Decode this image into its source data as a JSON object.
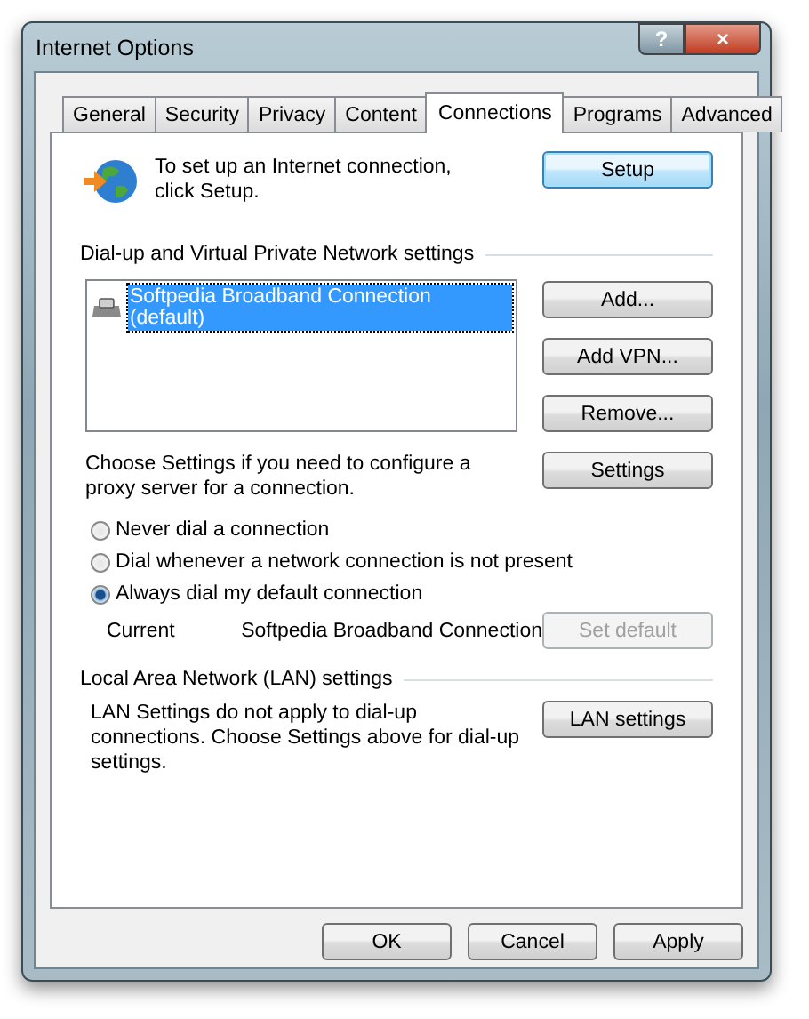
{
  "window": {
    "title": "Internet Options",
    "help": "?",
    "close": "×"
  },
  "tabs": [
    {
      "label": "General",
      "selected": false
    },
    {
      "label": "Security",
      "selected": false
    },
    {
      "label": "Privacy",
      "selected": false
    },
    {
      "label": "Content",
      "selected": false
    },
    {
      "label": "Connections",
      "selected": true
    },
    {
      "label": "Programs",
      "selected": false
    },
    {
      "label": "Advanced",
      "selected": false
    }
  ],
  "setup": {
    "text": "To set up an Internet connection, click Setup.",
    "button": {
      "label": "Setup",
      "focused": true
    }
  },
  "dialup": {
    "heading": "Dial-up and Virtual Private Network settings",
    "connections": [
      {
        "name": "Softpedia Broadband Connection (default)",
        "selected": true
      }
    ],
    "buttons": [
      "Add...",
      "Add VPN...",
      "Remove..."
    ],
    "proxy_text": "Choose Settings if you need to configure a proxy server for a connection.",
    "settings_button": "Settings",
    "options": [
      {
        "label": "Never dial a connection",
        "selected": false
      },
      {
        "label": "Dial whenever a network connection is not present",
        "selected": false
      },
      {
        "label": "Always dial my default connection",
        "selected": true
      }
    ],
    "current_label": "Current",
    "current_value": "Softpedia Broadband Connection",
    "set_default": {
      "label": "Set default",
      "disabled": true
    }
  },
  "lan": {
    "heading": "Local Area Network (LAN) settings",
    "text": "LAN Settings do not apply to dial-up connections. Choose Settings above for dial-up settings.",
    "button": "LAN settings"
  },
  "footer_buttons": [
    "OK",
    "Cancel",
    "Apply"
  ]
}
